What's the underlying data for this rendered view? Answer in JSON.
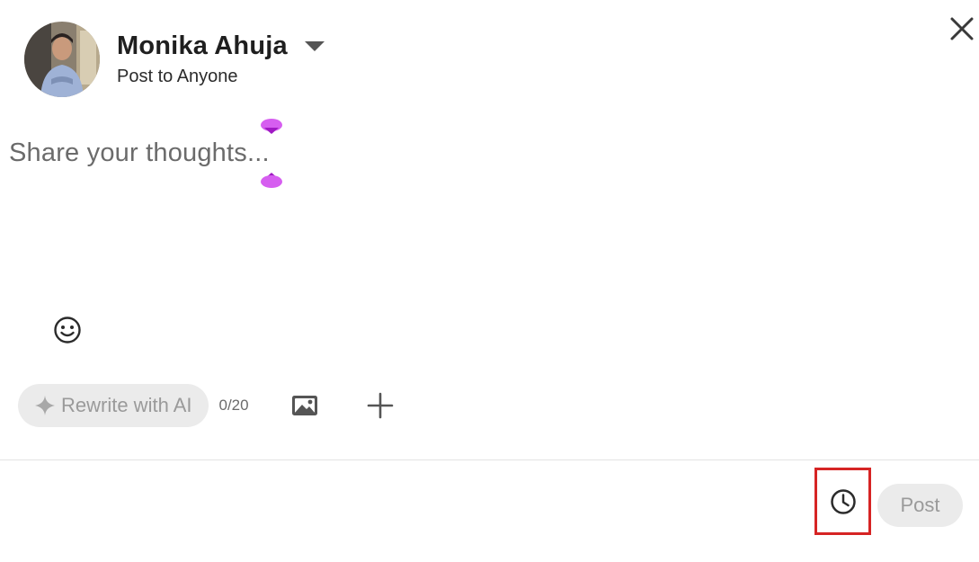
{
  "header": {
    "user_name": "Monika Ahuja",
    "audience": "Post to Anyone",
    "avatar_icon": "user-avatar-photo",
    "caret_icon": "caret-down-icon",
    "close_icon": "close-icon"
  },
  "editor": {
    "placeholder": "Share your thoughts...",
    "emoji_icon": "smiley-icon"
  },
  "toolbar": {
    "rewrite_label": "Rewrite with AI",
    "rewrite_icon": "sparkle-icon",
    "char_counter": "0/20",
    "media_icon": "image-icon",
    "more_icon": "plus-icon"
  },
  "footer": {
    "schedule_icon": "clock-icon",
    "post_label": "Post"
  },
  "colors": {
    "highlight_border": "#d62424",
    "ai_cursor": "#c72ee6",
    "disabled_button_bg": "#ebebeb",
    "disabled_button_text": "#9a9a9a"
  }
}
